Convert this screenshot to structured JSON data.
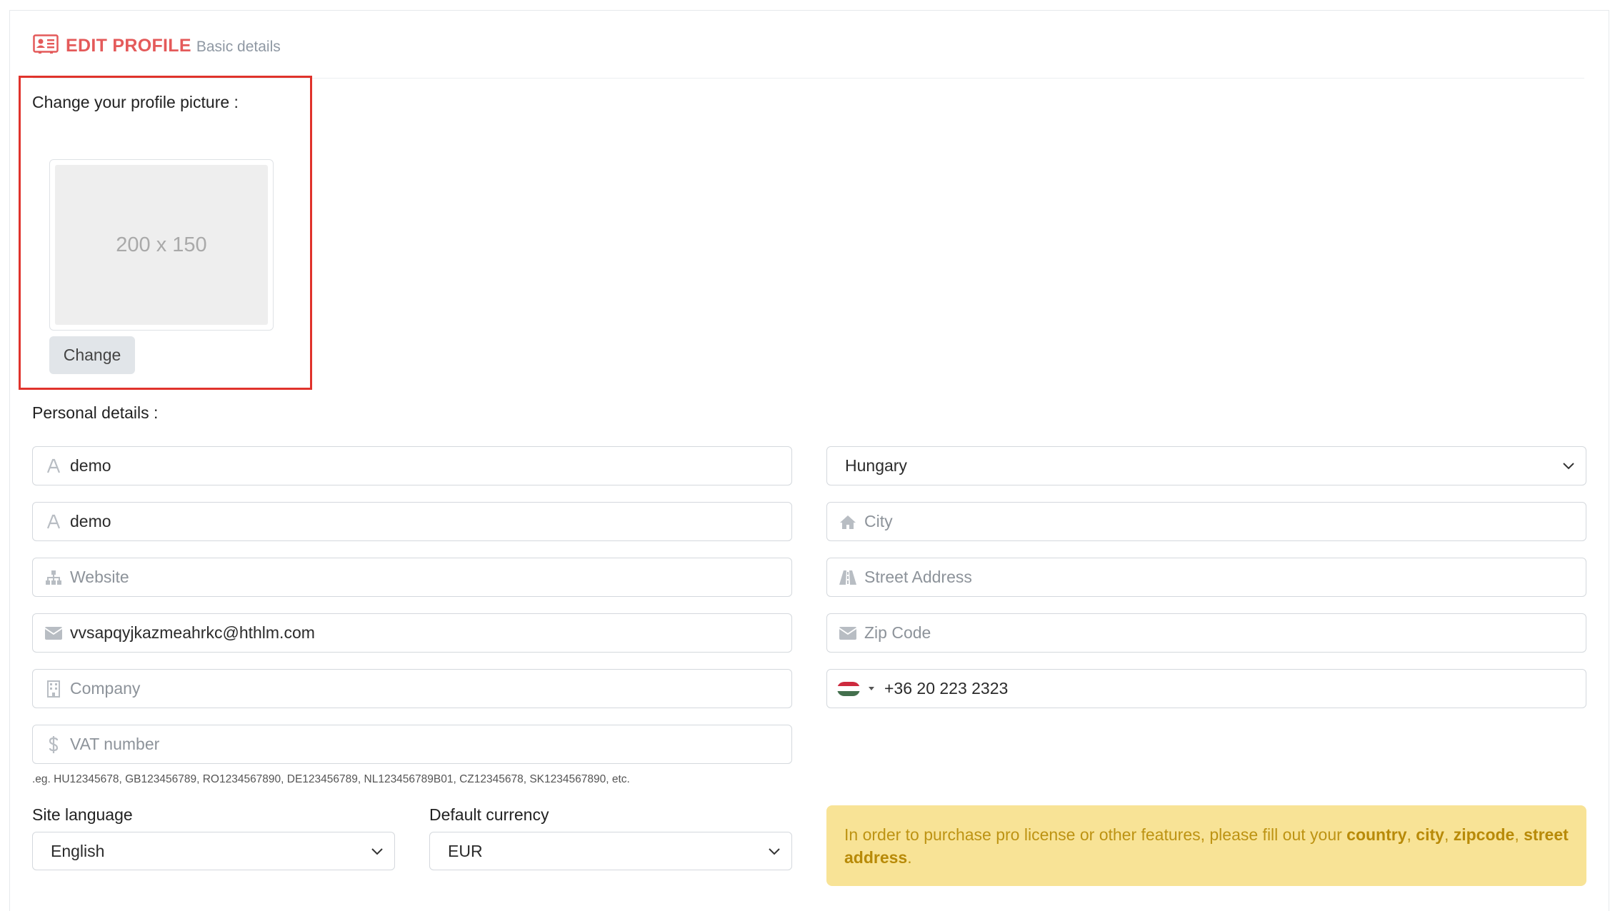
{
  "header": {
    "title": "EDIT PROFILE",
    "subtitle": "Basic details",
    "icon": "id-card-icon"
  },
  "profile_picture": {
    "label": "Change your profile picture :",
    "placeholder_text": "200 x 150",
    "change_button": "Change"
  },
  "personal": {
    "label": "Personal details :",
    "left_fields": [
      {
        "icon": "font-icon",
        "value": "demo",
        "placeholder": ""
      },
      {
        "icon": "font-icon",
        "value": "demo",
        "placeholder": ""
      },
      {
        "icon": "sitemap-icon",
        "value": "",
        "placeholder": "Website"
      },
      {
        "icon": "envelope-icon",
        "value": "vvsapqyjkazmeahrkc@hthlm.com",
        "placeholder": ""
      },
      {
        "icon": "building-icon",
        "value": "",
        "placeholder": "Company"
      },
      {
        "icon": "dollar-icon",
        "value": "",
        "placeholder": "VAT number"
      }
    ],
    "vat_hint": ".eg. HU12345678, GB123456789, RO1234567890, DE123456789, NL123456789B01, CZ12345678, SK1234567890, etc.",
    "country": "Hungary",
    "city_placeholder": "City",
    "street_placeholder": "Street Address",
    "zip_placeholder": "Zip Code",
    "phone": "+36 20 223 2323"
  },
  "site_language": {
    "label": "Site language",
    "value": "English"
  },
  "default_currency": {
    "label": "Default currency",
    "value": "EUR"
  },
  "alert": {
    "text_before": "In order to purchase pro license or other features, please fill out your ",
    "country": "country",
    "sep1": ", ",
    "city": "city",
    "sep2": ", ",
    "zipcode": "zipcode",
    "sep3": ", ",
    "street": "street address",
    "end": "."
  },
  "colors": {
    "accent": "#e45a5a",
    "alert_bg": "#f8e396",
    "alert_text": "#bd9313",
    "highlight": "#e0332c"
  }
}
